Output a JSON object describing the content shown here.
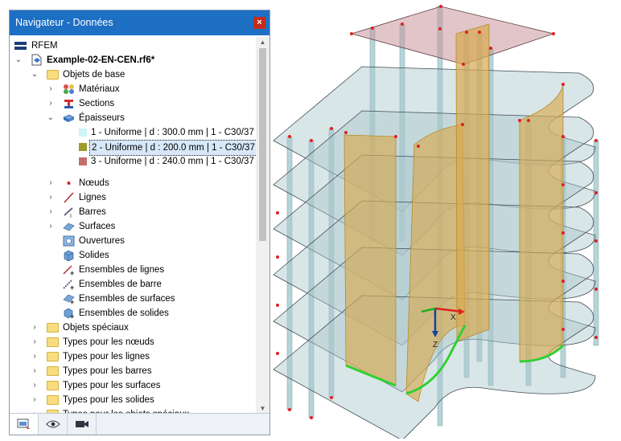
{
  "navigator": {
    "title": "Navigateur - Données",
    "close": "×",
    "root": "RFEM",
    "model": "Example-02-EN-CEN.rf6*",
    "base_objects": "Objets de base",
    "items": {
      "materials": "Matériaux",
      "sections": "Sections",
      "thicknesses": "Épaisseurs",
      "nodes": "Nœuds",
      "lines": "Lignes",
      "members": "Barres",
      "surfaces": "Surfaces",
      "openings": "Ouvertures",
      "solids": "Solides",
      "line_sets": "Ensembles de lignes",
      "member_sets": "Ensembles de barre",
      "surface_sets": "Ensembles de surfaces",
      "solid_sets": "Ensembles de solides"
    },
    "thickness_items": [
      {
        "label": "1 - Uniforme | d : 300.0 mm | 1 - C30/37",
        "color": "#cdf6f6"
      },
      {
        "label": "2 - Uniforme | d : 200.0 mm | 1 - C30/37",
        "color": "#9f9a2d"
      },
      {
        "label": "3 - Uniforme | d : 240.0 mm | 1 - C30/37",
        "color": "#c46e6e"
      }
    ],
    "folders": {
      "special": "Objets spéciaux",
      "node_types": "Types pour les nœuds",
      "line_types": "Types pour les lignes",
      "member_types": "Types pour les barres",
      "surface_types": "Types pour les surfaces",
      "solid_types": "Types pour les solides",
      "special_types": "Types pour les objets spéciaux"
    }
  },
  "viewport": {
    "axis_x": "X",
    "axis_z": "Z"
  }
}
